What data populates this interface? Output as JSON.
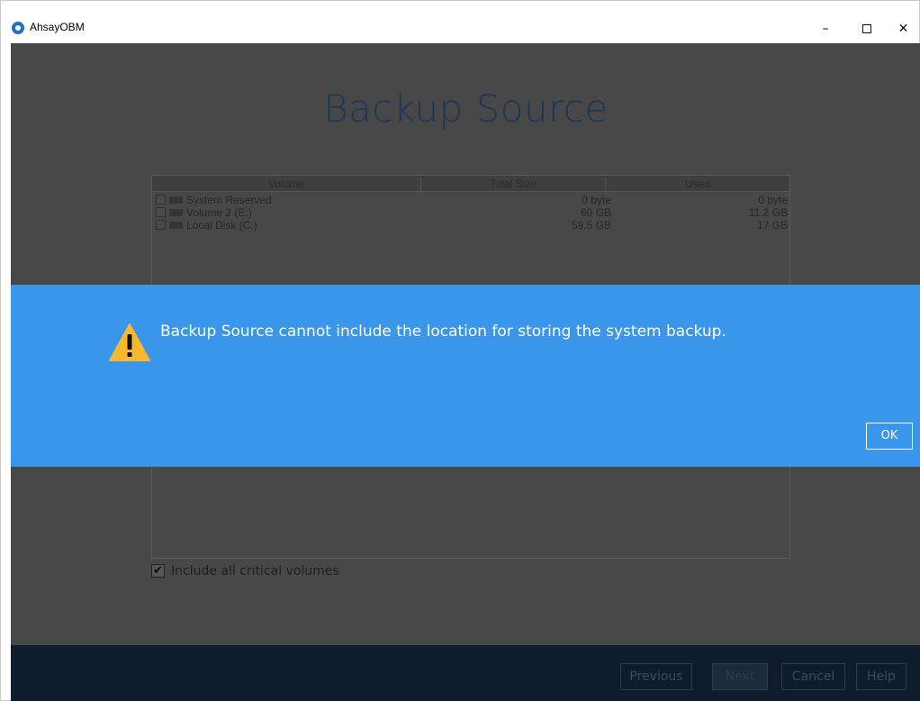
{
  "window": {
    "app_title": "AhsayOBM"
  },
  "page": {
    "title": "Backup Source"
  },
  "table": {
    "headers": [
      "Volume",
      "Total Size",
      "Used"
    ],
    "rows": [
      {
        "name": "System Reserved",
        "size": "0 byte",
        "used": "0 byte"
      },
      {
        "name": "Volume 2 (E:)",
        "size": "60 GB",
        "used": "11.2 GB"
      },
      {
        "name": "Local Disk (C:)",
        "size": "59.5 GB",
        "used": "17 GB"
      }
    ]
  },
  "critical": {
    "label": "Include all critical volumes",
    "checked": true
  },
  "footer": {
    "previous": "Previous",
    "next": "Next",
    "cancel": "Cancel",
    "help": "Help"
  },
  "modal": {
    "message": "Backup Source cannot include the location for storing the system backup.",
    "ok": "OK",
    "icon": "warning-icon"
  },
  "colors": {
    "modal_bg": "#3a96ea",
    "footer_bg": "#0e1c2e",
    "accent": "#1f71c8"
  }
}
